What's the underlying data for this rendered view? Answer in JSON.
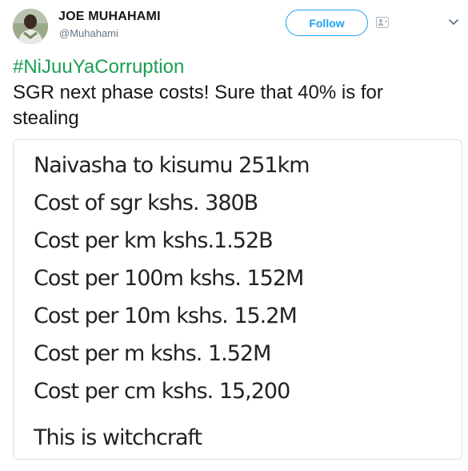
{
  "author": {
    "name": "JOE MUHAHAMI",
    "handle": "@Muhahami"
  },
  "actions": {
    "follow_label": "Follow"
  },
  "icons": {
    "avatar": "user-photo",
    "follow_extra": "person-add-icon",
    "menu": "chevron-down-icon"
  },
  "tweet": {
    "hashtag": "#NiJuuYaCorruption",
    "text": "SGR next phase costs! Sure that 40% is for stealing"
  },
  "media": {
    "lines": [
      "Naivasha to kisumu 251km",
      "Cost of sgr kshs. 380B",
      "Cost per km kshs.1.52B",
      "Cost per 100m kshs. 152M",
      "Cost per 10m kshs. 15.2M",
      "Cost per m kshs. 1.52M",
      "Cost per cm kshs. 15,200",
      "This is witchcraft"
    ]
  },
  "colors": {
    "accent": "#1da1f2",
    "hashtag": "#1b9e54",
    "text": "#14171a",
    "secondary": "#657786",
    "border": "#d9dee2"
  }
}
